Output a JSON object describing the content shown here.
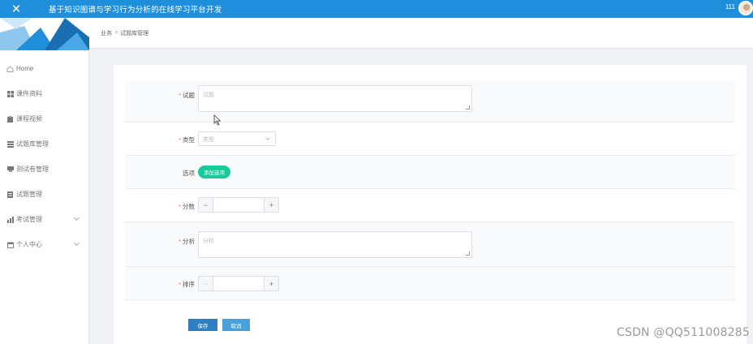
{
  "header": {
    "title": "基于知识图谱与学习行为分析的在线学习平台开发",
    "username": "111"
  },
  "sidebar": {
    "items": [
      {
        "label": "Home",
        "icon": "home-icon"
      },
      {
        "label": "课件资料",
        "icon": "grid-icon"
      },
      {
        "label": "课程视频",
        "icon": "clipboard-icon"
      },
      {
        "label": "试题库管理",
        "icon": "list-icon"
      },
      {
        "label": "测试卷管理",
        "icon": "paper-icon"
      },
      {
        "label": "试题管理",
        "icon": "document-icon"
      },
      {
        "label": "考试管理",
        "icon": "chart-icon",
        "expandable": true
      },
      {
        "label": "个人中心",
        "icon": "calendar-icon",
        "expandable": true
      }
    ]
  },
  "breadcrumb": {
    "items": [
      "业务",
      "试题库管理"
    ],
    "separator": ">"
  },
  "form": {
    "question": {
      "label": "试题",
      "placeholder": "试题",
      "required": true
    },
    "type": {
      "label": "类型",
      "placeholder": "类型",
      "required": true
    },
    "options": {
      "label": "选项",
      "add_button": "添加选项",
      "required": false
    },
    "score": {
      "label": "分数",
      "value": "",
      "required": true
    },
    "analysis": {
      "label": "分析",
      "placeholder": "分析",
      "required": true
    },
    "sort": {
      "label": "排序",
      "value": "",
      "required": true
    },
    "save_label": "保存",
    "cancel_label": "取消"
  },
  "colors": {
    "topbar": "#1f8fdc",
    "add_option": "#18c99a",
    "save": "#2f7fc0",
    "cancel": "#4aa0d8",
    "required": "#f56c6c"
  },
  "watermark": "CSDN @QQ511008285"
}
